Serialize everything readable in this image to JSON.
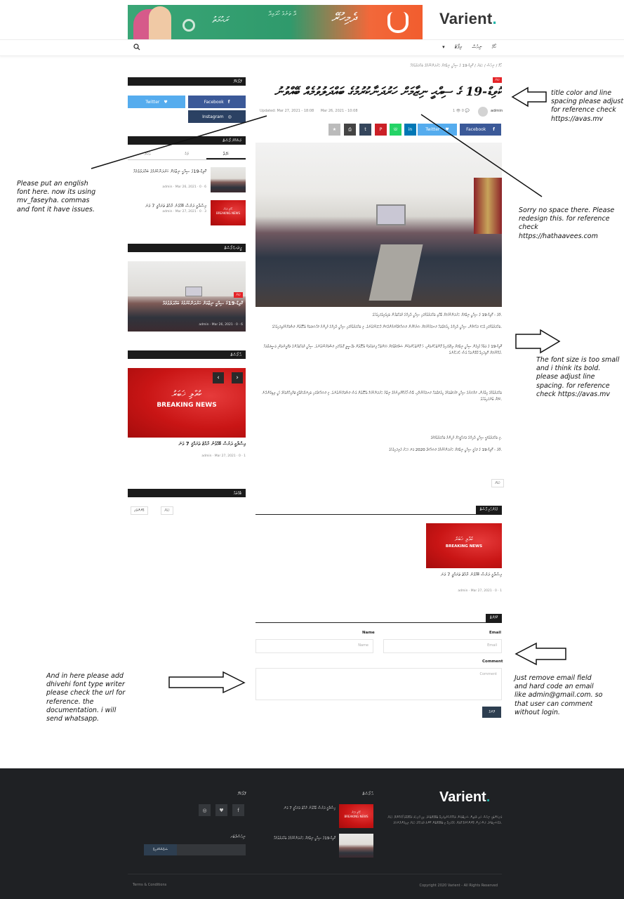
{
  "header": {
    "logo_text": "Varient",
    "logo_dot": ".",
    "banner_text_1": "ރަޙުމަތު",
    "banner_text_2": "ދޭ ތަނެއް ހޯދައިދޭ",
    "banner_text_3": "ދެމިހުރޭ",
    "nav_items": [
      "ހޯމް",
      "ނިއުސް",
      "ރިޕޯޓް"
    ],
    "nav_arrow": "▾"
  },
  "breadcrumb": "ހޯމް / ނިއުސް / ޚަބަރު / ކޮވިޑް-19 ގެ ސިއްޙީ ނިޒާމަށް ހަރުދަނާކުރުމުގެ ބައްދަލުވުމެއް",
  "sidebar": {
    "follow_title": "ފޮލޯކުރޭ",
    "social": [
      {
        "name": "Facebook",
        "glyph": "f"
      },
      {
        "name": "Twitter",
        "glyph": "♥"
      },
      {
        "name": "Instagram",
        "glyph": "◎"
      }
    ],
    "popular_title": "މަޝްހޫރު ޕޯސްޓް",
    "tabs": [
      "ހަފްތާ",
      "މަހު",
      "އަހަރު"
    ],
    "popular_posts": [
      {
        "title": "ކޮވިޑް-19ގެ ސިއްޙީ ނިޒާމަށް ހަރުދަނާކުރުމުގެ ބައްދަލުވުމެއް",
        "meta": "admin · Mar 26, 2021 · 0 · 6"
      },
      {
        "title": "އިސްލާމީ ދަރުސް ބޭއްވުނު ރާއްޖެ ތަރައްޤީ 7 ވަނަ",
        "meta": "admin · Mar 27, 2021 · 0 · 3"
      }
    ],
    "featured_title": "ފީޗަރޑް ޕޯސްޓް",
    "featured": {
      "badge": "ޚަބަރު",
      "title": "ކޮވިޑް-19ގެ ސިއްޙީ ނިޒާމަށް ހަރުދަނާކުރުމުގެ ބައްދަލުވުމެއް",
      "meta": "admin · Mar 26, 2021 · 0 · 6"
    },
    "recent_title": "އާ ޕޯސްޓް",
    "breaking_dv": "ކުއްލި ޚަބަރު",
    "breaking_en": "BREAKING NEWS",
    "recent_post": {
      "title": "އިސްލާމީ ދަރުސް ބޭއްވުނު ރާއްޖެ ތަރައްޤީ 7 ވަނަ",
      "meta": "admin · Mar 27, 2021 · 0 · 1"
    },
    "prev_icon": "‹",
    "next_icon": "›",
    "tags_title": "ޓެގްތައް",
    "tags": [
      "ޚަބަރު",
      "ބޭނުންތެރި"
    ]
  },
  "article": {
    "badge": "ޚަބަރު",
    "title": "ކޮވިޑް-19 ގެ ސިއްޙީ ނިޒާމަށް ހަރުދަނާކުރުމުގެ ބައްދަލުވުމެއް ބޭއްވުނު",
    "author": "admin",
    "updated": "Updated: Mar 27, 2021 - 18:08",
    "published": "Mar 26, 2021 - 10:08",
    "views": "1  👁  0  💬",
    "share_buttons": [
      {
        "label": "Facebook",
        "glyph": "f",
        "color": "#3b5998"
      },
      {
        "label": "Twitter",
        "glyph": "♥",
        "color": "#55acee"
      },
      {
        "label": "",
        "glyph": "in",
        "color": "#0077b5"
      },
      {
        "label": "",
        "glyph": "☏",
        "color": "#25d366"
      },
      {
        "label": "",
        "glyph": "P",
        "color": "#cb2027"
      },
      {
        "label": "",
        "glyph": "t",
        "color": "#35465c"
      },
      {
        "label": "",
        "glyph": "⎙",
        "color": "#444444"
      },
      {
        "label": "",
        "glyph": "★",
        "color": "#bbbbbb"
      }
    ],
    "paragraphs": [
      "މާލެ - ކޮވިޑް-19 ގެ ސިއްޙީ ނިޒާމަށް ހަރުދަނާކުރުމަށް ބޭއްވި ބައްދަލުވުމުގައި ސިއްޙީ ދާއިރާގެ މުވައްޒަފުން ބައިވެރިވެފައިވެއެވެ.",
      "ބައްދަލުވުމުގައި ވާހަކަ ދައްކަމުން، ސިއްޙީ ދާއިރާގެ ހިދުމަތްތައް ރަނގަޅުކުރުމަށް ސަރުކާރުން މަސައްކަތްކުރަމުންދާކަން ފާހަގަކުރެވުނެވެ. މި ބައްދަލުވުމުގައި ސިއްޙީ ދާއިރާގެ މުހިންމު މައްސަލަތަކާ ބެހޭގޮތުން މަޝްވަރާކުރެވިފައިވެއެވެ.",
      "ކޮވިޑް-19 ގެ ވަބާއާ ގުޅިގެން ސިއްޙީ ނިޒާމަށް ދިމާވެފައިވާ ގޮންޖެހުންތަކާއި، އެ ގޮންޖެހުންތަކުން ސަލާމަތްވުމަށް އަޅަންޖެހޭ ފިޔަވަޅުތަކާ ބެހޭގޮތުން ތަފްސީލީ ގޮތެއްގައި މަޝްވަރާކުރެވުނެވެ. ސިއްޙީ މުވައްޒަފުންގެ ތަމްރީނުތަކާއި ވަސީލަތްތައް ފުޅާކުރުމަށް ރޭވިފައިވާ ޕްލޭންތައް ވެސް ހުށަހެޅުނެވެ.",
      "ބައްދަލުވުމުގެ އިތުރުން، ރަށްރަށުގެ ސިއްޙީ މަރުކަޒުތަކުގެ ހިދުމަތްތައް ރަނގަޅުކުރުމާއި، ބޭސް ފޯރުކޮށްދިނުމުގެ ނިޒާމު ހަރުދަނާކުރުމާ ބެހޭގޮތުން ވެސް މަޝްވަރާކުރެވުނެވެ. މި މަސައްކަތުގައި ބައިނަލްއަޤުވާމީ ޖަމްޢިއްޔާތަކުގެ އެހީ ލިބިގެންދާނެ ކަމަށް ބުނެފައިވެއެވެ.",
      "މި ބައްދަލުވުމަކީ ސިއްޙީ ދާއިރާގެ ތަރައްޤީއަށް މުހިންމު ބައްދަލުވުމެކެވެ.",
      "މާލެ - ކޮވިޑް-19 ގެ ޤައުމީ ސިއްޙީ ނިޒާމަށް ހަރުދަނާކުރުމުގެ މަސައްކަތް 2020 ވަނަ އަހަރު ފެށިފައިވެއެވެ."
    ],
    "tags": [
      "ޚަބަރު"
    ]
  },
  "related": {
    "title": "ގުޅުންހުރި ޕޯސްޓް",
    "breaking_dv": "ކުއްލި ޚަބަރު",
    "breaking_en": "BREAKING NEWS",
    "post_title": "އިސްލާމީ ދަރުސް ބޭއްވުނު ރާއްޖެ ތަރައްޤީ 7 ވަނަ",
    "meta": "admin · Mar 27, 2021 · 0 · 1"
  },
  "comments": {
    "title": "ކޮމެންޓް",
    "name_label": "Name",
    "email_label": "Email",
    "comment_label": "Comment",
    "name_placeholder": "Name",
    "email_placeholder": "Email",
    "comment_placeholder": "Comment",
    "submit_label": "ފޮނުވާ"
  },
  "annotations": [
    "title color and line spacing please adjust for reference check https://avas.mv",
    "Please put an english font here. now its using mv_faseyha. commas and font it have issues.",
    "Sorry no space there. Please redesign this. for reference check https://hathaavees.com",
    "The font size is too small and i think its bold. please adjust line spacing. for reference check https://avas.mv",
    "And in here please add dhivehi font type writer please check the url for reference. the documentation. i will send whatsapp.",
    "Just remove email field and hard code an email like admin@gmail.com. so that user can comment without login."
  ],
  "footer": {
    "logo_text": "Varient",
    "about": "ވަރިއަންޓަކީ ނިއުސް އަދި މެގަޒިން ސައިޓްތަކަށް ތައްޔާރުކުރެވިފައިވާ ޓެމްޕްލޭޓެކެވެ. މިއީ ފުރިހަމަ މަޢުލޫމާތު ފޯރުކޮށްދޭ ޚަބަރު ވެބްސައިޓެކެވެ. ފަސޭހައިން ބޭނުންކުރެވޭ ގޮތަށް ހަދާފައިވާ މި ޓެމްޕްލޭޓުން ކޮންމެ ދުވަހެއްގެ ޚަބަރު ލިބިގެންދާނެއެވެ.",
    "recent_title": "އާ ޕޯސްޓް",
    "recent": [
      "އިސްލާމީ ދަރުސް ބޭއްވުނު ރާއްޖެ ތަރައްޤީ 7 ވަނަ",
      "ކޮވިޑް-19ގެ ސިއްޙީ ނިޒާމަށް ހަރުދަނާކުރުމުގެ ބައްދަލުވުމެއް"
    ],
    "follow_title": "ފޮލޯކުރޭ",
    "newsletter_title": "ނިއުސްލެޓަރ",
    "subscribe_label": "ސަބްސްކްރައިބް",
    "social_glyphs": [
      "f",
      "♥",
      "◎"
    ],
    "copyright": "Copyright 2020 Varient - All Rights Reserved",
    "terms": "Terms & Conditions",
    "breaking_dv": "ކުއްލި ޚަބަރު",
    "breaking_en": "BREAKING NEWS"
  }
}
